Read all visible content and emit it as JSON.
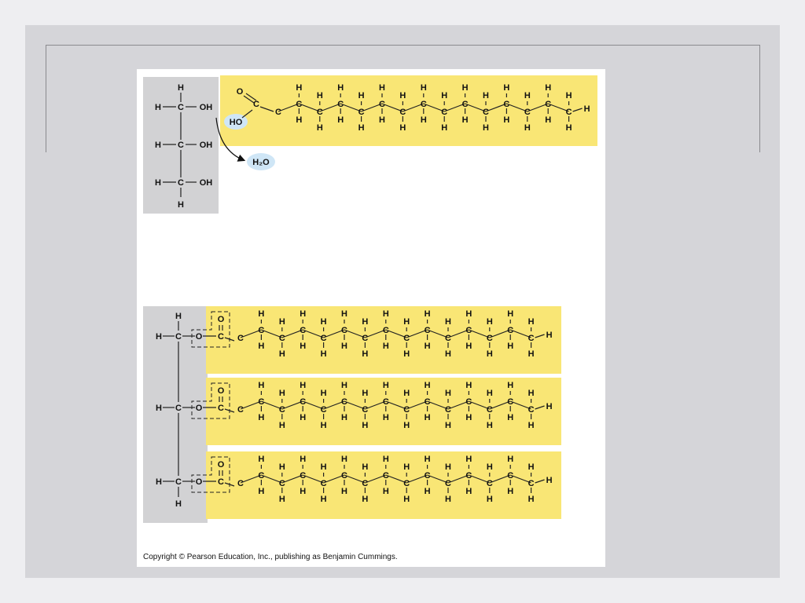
{
  "figure": {
    "glycerol": {
      "atom_h": "H",
      "atom_c": "C",
      "hydroxyl": "OH"
    },
    "fatty_acid": {
      "oxygen": "O",
      "hydroxyl": "HO",
      "carbon": "C",
      "hydrogen": "H",
      "carbon_count": 16
    },
    "water_label": "H₂O",
    "fat": {
      "oxygen": "O",
      "carbon": "C",
      "hydrogen": "H",
      "chains": 3
    },
    "copyright": "Copyright © Pearson Education, Inc., publishing as Benjamin Cummings."
  },
  "colors": {
    "slide_background": "#d5d5d9",
    "page_background": "#eeeef1",
    "fatty_acid_highlight": "#f9e675",
    "glycerol_highlight": "#d2d2d4",
    "water_bubble": "#cfe6f6"
  }
}
